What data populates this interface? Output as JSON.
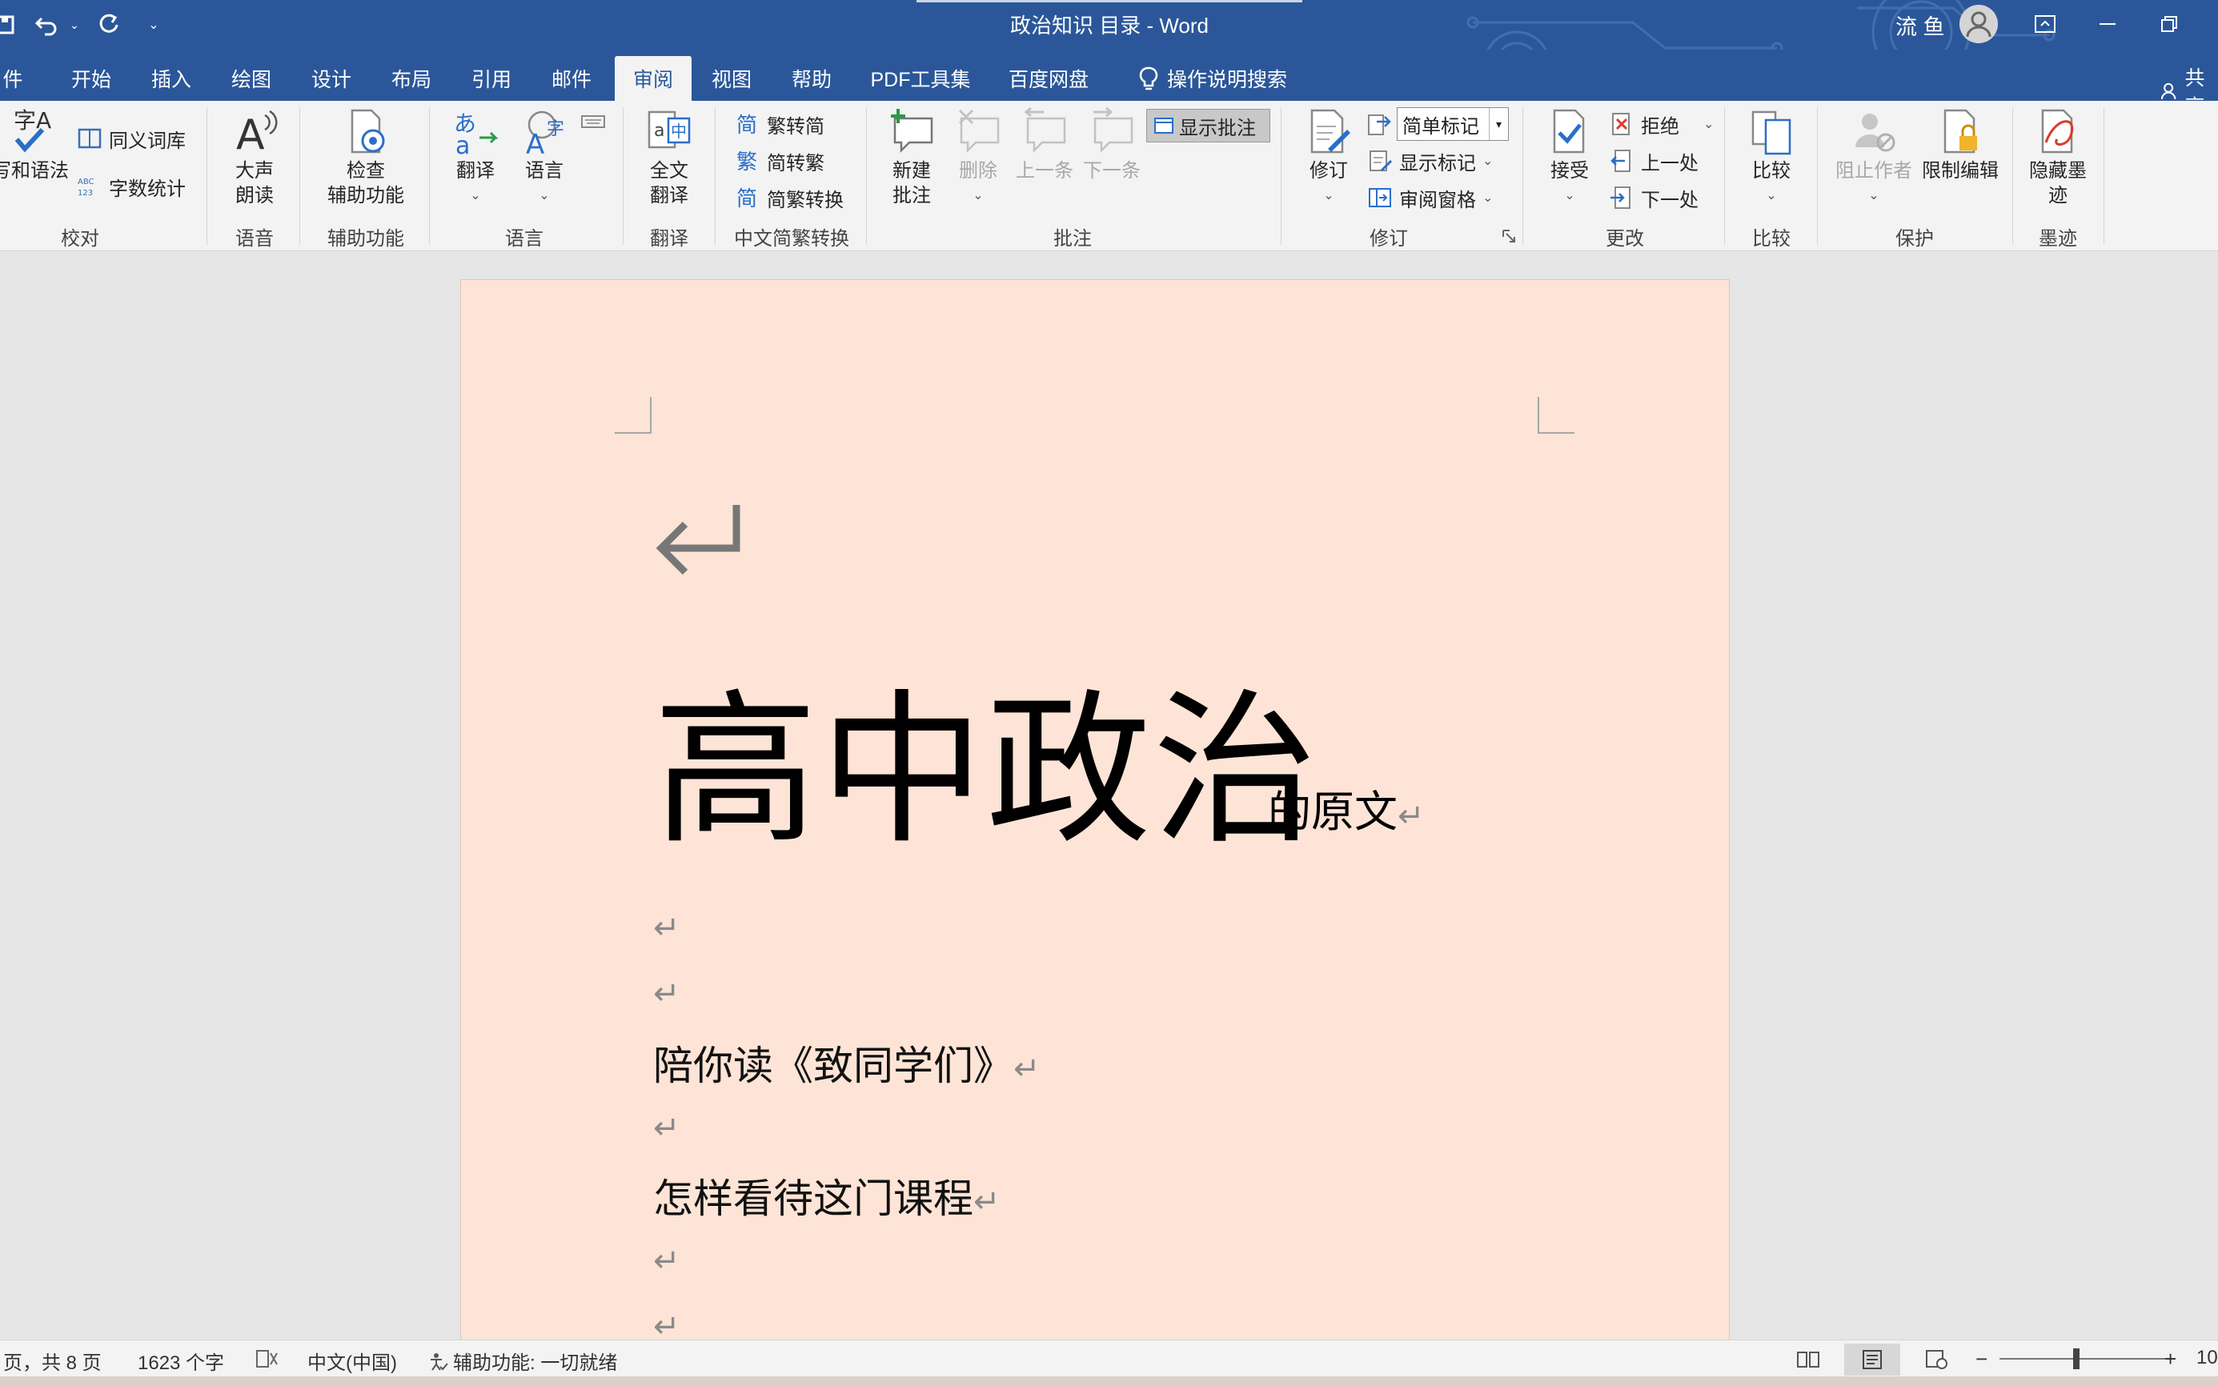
{
  "window": {
    "title": "政治知识 目录  -  Word",
    "user": "流 鱼"
  },
  "tabs": [
    "件",
    "开始",
    "插入",
    "绘图",
    "设计",
    "布局",
    "引用",
    "邮件",
    "审阅",
    "视图",
    "帮助",
    "PDF工具集",
    "百度网盘"
  ],
  "tell_me": "操作说明搜索",
  "share": "共享",
  "ribbon": {
    "proofing": {
      "spell": "写和语法",
      "thesaurus": "同义词库",
      "word_count": "字数统计",
      "label": "校对"
    },
    "speech": {
      "read_aloud": "大声\n朗读",
      "label": "语音"
    },
    "accessibility": {
      "check": "检查\n辅助功能",
      "label": "辅助功能"
    },
    "language": {
      "translate": "翻译",
      "language": "语言",
      "label": "语言"
    },
    "translation": {
      "full": "全文\n翻译",
      "label": "翻译"
    },
    "chinese": {
      "to_simplified": "繁转简",
      "to_traditional": "简转繁",
      "convert": "简繁转换",
      "label": "中文简繁转换"
    },
    "comments": {
      "new": "新建\n批注",
      "delete": "删除",
      "prev": "上一条",
      "next": "下一条",
      "show": "显示批注",
      "label": "批注"
    },
    "tracking": {
      "track": "修订",
      "markup_combo": "简单标记",
      "show_markup": "显示标记",
      "pane": "审阅窗格",
      "label": "修订"
    },
    "changes": {
      "accept": "接受",
      "reject": "拒绝",
      "prev": "上一处",
      "next": "下一处",
      "label": "更改"
    },
    "compare": {
      "compare": "比较",
      "label": "比较"
    },
    "protect": {
      "block": "阻止作者",
      "restrict": "限制编辑",
      "label": "保护"
    },
    "ink": {
      "hide": "隐藏墨\n迹",
      "label": "墨迹"
    }
  },
  "document": {
    "title_big": "高中政治",
    "title_small": "的原文",
    "lines": [
      "陪你读《致同学们》",
      "怎样看待这门课程"
    ]
  },
  "status": {
    "page": "页，共 8 页",
    "words": "1623 个字",
    "lang": "中文(中国)",
    "accessibility": "辅助功能: 一切就绪",
    "zoom": "10"
  },
  "colors": {
    "brand": "#2b579a",
    "page_bg": "#fde4d6"
  }
}
